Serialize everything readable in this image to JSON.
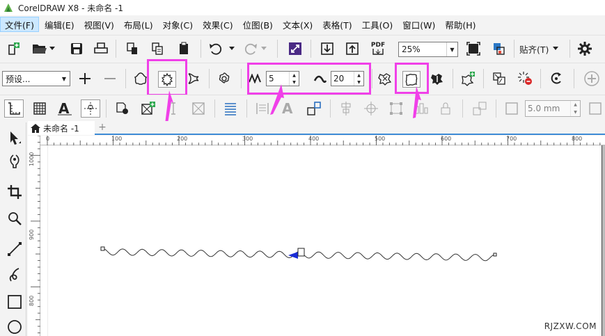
{
  "window": {
    "title": "CorelDRAW X8 - 未命名 -1"
  },
  "menu": [
    {
      "label": "文件(F)",
      "active": true
    },
    {
      "label": "编辑(E)"
    },
    {
      "label": "视图(V)"
    },
    {
      "label": "布局(L)"
    },
    {
      "label": "对象(C)"
    },
    {
      "label": "效果(C)"
    },
    {
      "label": "位图(B)"
    },
    {
      "label": "文本(X)"
    },
    {
      "label": "表格(T)"
    },
    {
      "label": "工具(O)"
    },
    {
      "label": "窗口(W)"
    },
    {
      "label": "帮助(H)"
    }
  ],
  "standard_toolbar": {
    "pdf_label": "PDF",
    "zoom_value": "25%",
    "snap_label": "贴齐(T)"
  },
  "property_bar": {
    "preset_value": "预设...",
    "amplitude_value": "5",
    "frequency_value": "20"
  },
  "object_bar": {
    "outline_width": "5.0 mm"
  },
  "document": {
    "tab_label": "未命名 -1"
  },
  "rulers": {
    "horizontal_labels": [
      "0",
      "100",
      "200",
      "300",
      "400",
      "500",
      "600",
      "700",
      "800"
    ],
    "vertical_labels": [
      "1000",
      "900",
      "800"
    ]
  },
  "watermark": "RJZXW.COM",
  "colors": {
    "accent": "#3d8bd6",
    "highlight": "#f040e8",
    "menu_active": "#cce8ff"
  }
}
